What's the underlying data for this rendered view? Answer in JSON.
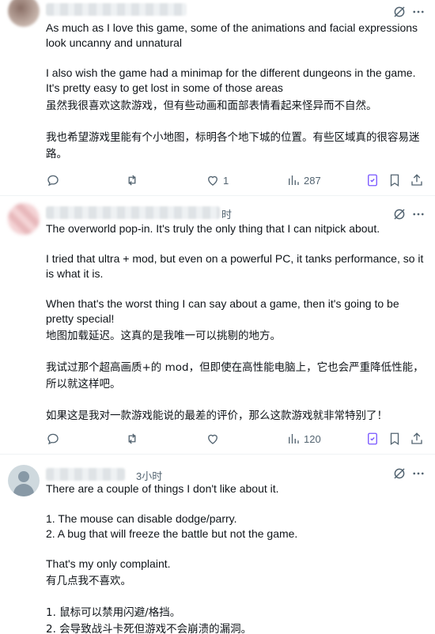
{
  "posts": [
    {
      "time": "",
      "english_paragraphs": [
        "As much as I love this game, some of the animations and facial expressions look uncanny and unnatural",
        "I also wish the game had a minimap for the different dungeons in the game. It's pretty easy to get lost in some of those areas"
      ],
      "chinese_paragraphs": [
        "虽然我很喜欢这款游戏，但有些动画和面部表情看起来怪异而不自然。",
        "我也希望游戏里能有个小地图，标明各个地下城的位置。有些区域真的很容易迷路。"
      ],
      "likes": "1",
      "views": "287"
    },
    {
      "time": "时",
      "english_paragraphs": [
        "The overworld pop-in.  It's truly the only thing that I can nitpick about.",
        "I tried that ultra + mod, but even on a powerful PC, it tanks performance, so it is what it is.",
        "When that's the worst thing I can say about a game, then it's going to be pretty special!"
      ],
      "chinese_paragraphs": [
        "地图加载延迟。这真的是我唯一可以挑剔的地方。",
        "我试过那个超高画质+的 mod，但即使在高性能电脑上，它也会严重降低性能，所以就这样吧。",
        "如果这是我对一款游戏能说的最差的评价，那么这款游戏就非常特别了！"
      ],
      "likes": "",
      "views": "120"
    },
    {
      "time": "3小时",
      "english_paragraphs": [
        "There are a couple of things I don't like about it.",
        "1. The mouse can disable dodge/parry.\n2. A bug that will freeze the battle but not the game.",
        "That's my only complaint."
      ],
      "chinese_paragraphs": [
        "有几点我不喜欢。",
        "1. 鼠标可以禁用闪避/格挡。\n2. 会导致战斗卡死但游戏不会崩溃的漏洞。"
      ]
    }
  ],
  "colors": {
    "text": "#0f1419",
    "muted": "#536471",
    "accent": "#7856ff",
    "divider": "#eff3f4"
  },
  "icons": [
    "grok-icon",
    "more-icon",
    "reply-icon",
    "repost-icon",
    "like-icon",
    "views-icon",
    "grok-share-icon",
    "bookmark-icon",
    "share-icon"
  ]
}
